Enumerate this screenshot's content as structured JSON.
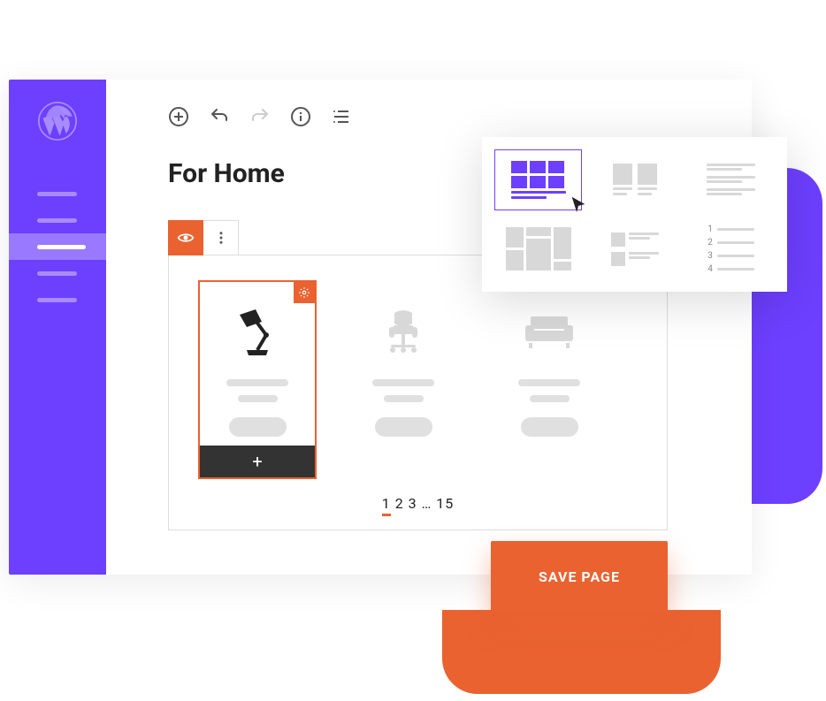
{
  "colors": {
    "accent_purple": "#6d3fff",
    "accent_orange": "#e96230"
  },
  "sidebar": {
    "logo": "wordpress",
    "items": [
      {
        "active": false
      },
      {
        "active": false
      },
      {
        "active": true
      },
      {
        "active": false
      },
      {
        "active": false
      }
    ]
  },
  "toolbar": {
    "add": "add",
    "undo": "undo",
    "redo": "redo",
    "info": "info",
    "outline": "outline"
  },
  "page_title": "For Home",
  "block_controls": {
    "preview": "preview",
    "more": "more"
  },
  "products": [
    {
      "icon": "lamp",
      "selected": true,
      "has_gear": true,
      "has_add": true
    },
    {
      "icon": "chair",
      "selected": false
    },
    {
      "icon": "sofa",
      "selected": false
    }
  ],
  "pagination": {
    "pages": [
      "1",
      "2",
      "3",
      "…",
      "15"
    ],
    "current": "1"
  },
  "save_button_label": "SAVE PAGE",
  "layout_popup": {
    "options": [
      {
        "id": "grid-3x2",
        "selected": true
      },
      {
        "id": "cards-lines",
        "selected": false
      },
      {
        "id": "list-lines",
        "selected": false
      },
      {
        "id": "masonry",
        "selected": false
      },
      {
        "id": "row-lines",
        "selected": false
      },
      {
        "id": "numbered-list",
        "selected": false
      }
    ],
    "numbered": [
      "1",
      "2",
      "3",
      "4"
    ]
  }
}
